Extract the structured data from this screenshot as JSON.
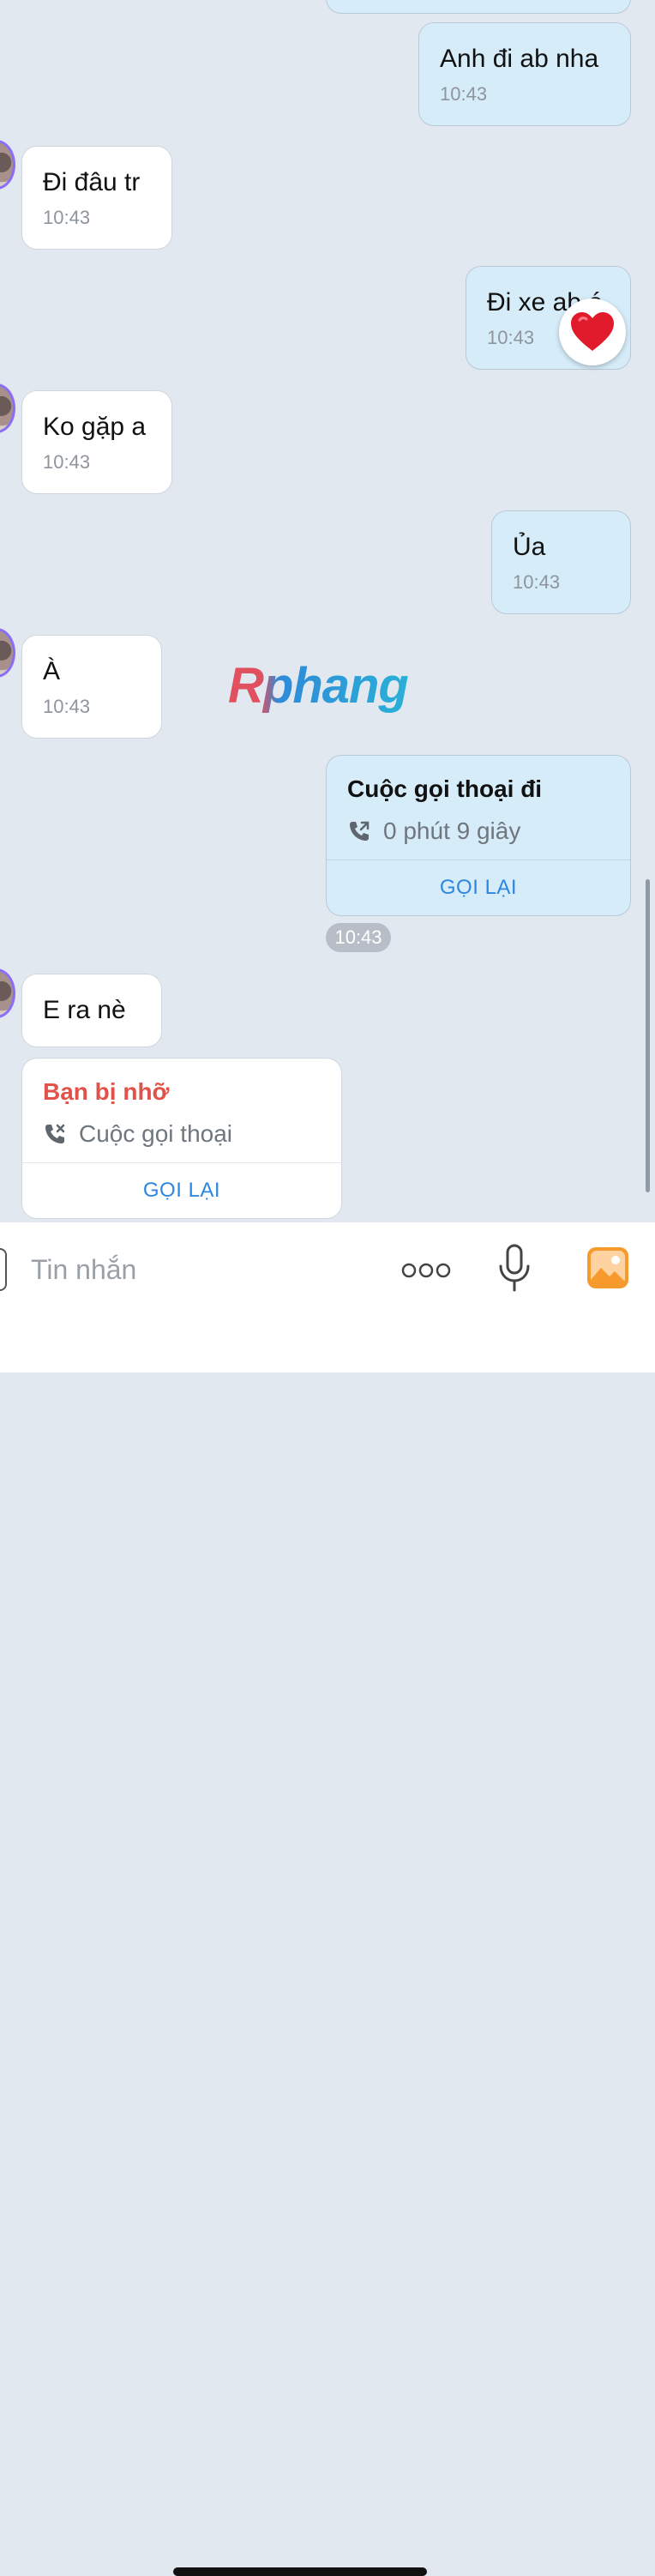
{
  "messages": [
    {
      "direction": "out",
      "text": "Anh đi ab nha",
      "time": "10:43"
    },
    {
      "direction": "in",
      "text": "Đi đâu tr",
      "time": "10:43"
    },
    {
      "direction": "out",
      "text": "Đi xe ab á",
      "time": "10:43",
      "reaction": "heart"
    },
    {
      "direction": "in",
      "text": "Ko gặp a",
      "time": "10:43"
    },
    {
      "direction": "out",
      "text": "Ủa",
      "time": "10:43"
    },
    {
      "direction": "in",
      "text": "À",
      "time": "10:43"
    },
    {
      "direction": "in",
      "text": "E ra nè"
    }
  ],
  "outgoing_call": {
    "title": "Cuộc gọi thoại đi",
    "duration": "0 phút 9 giây",
    "action": "GỌI LẠI",
    "time": "10:43",
    "icon": "phone-outgoing-icon"
  },
  "missed_call": {
    "title": "Bạn bị nhỡ",
    "subtitle": "Cuộc gọi thoại",
    "action": "GỌI LẠI",
    "title_color": "#e0524a",
    "icon": "phone-missed-icon"
  },
  "watermark": "Rphang",
  "composer": {
    "placeholder": "Tin nhắn",
    "icons": [
      "more-icon",
      "microphone-icon",
      "gallery-icon"
    ]
  },
  "colors": {
    "background": "#e2e8f0",
    "outgoing_bubble": "#d6ecf9",
    "incoming_bubble": "#ffffff",
    "accent": "#2d86e0",
    "gallery_icon": "#f79a2d"
  }
}
